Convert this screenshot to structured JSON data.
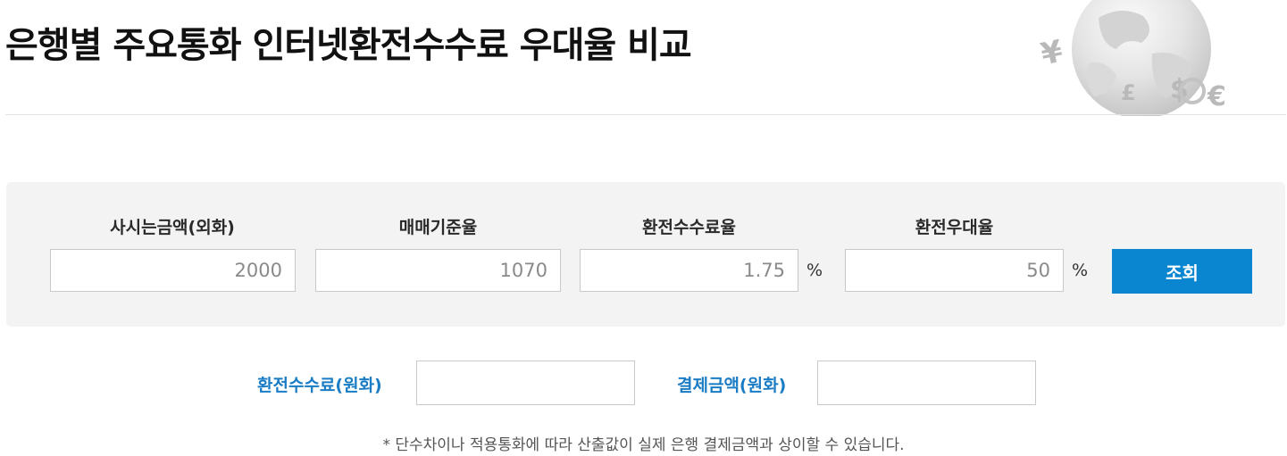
{
  "header": {
    "title": "은행별 주요통화 인터넷환전수수료 우대율 비교"
  },
  "calculator": {
    "amount": {
      "label": "사시는금액(외화)",
      "value": "2000"
    },
    "base_rate": {
      "label": "매매기준율",
      "value": "1070"
    },
    "fee_rate": {
      "label": "환전수수료율",
      "value": "1.75",
      "unit": "%"
    },
    "discount_rate": {
      "label": "환전우대율",
      "value": "50",
      "unit": "%"
    },
    "query_label": "조회"
  },
  "results": {
    "fee_krw": {
      "label": "환전수수료(원화)",
      "value": ""
    },
    "payment_krw": {
      "label": "결제금액(원화)",
      "value": ""
    }
  },
  "footnote": "* 단수차이나 적용통화에 따라 산출값이 실제 은행 결제금액과 상이할 수 있습니다.",
  "colors": {
    "accent": "#0a85cf",
    "result_label": "#1a7cc4",
    "panel_background": "#f3f3f3"
  },
  "icons": {
    "decoration": "globe-currency-icon"
  }
}
